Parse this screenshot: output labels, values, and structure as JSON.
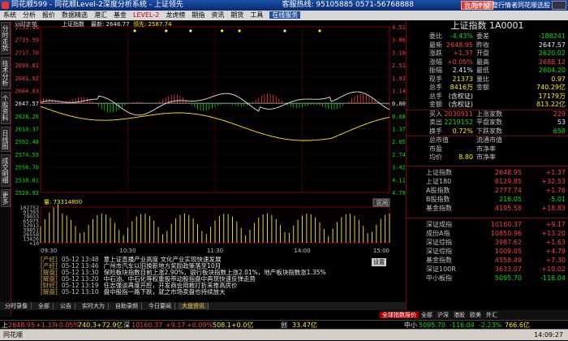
{
  "titlebar": {
    "title": "同花顺599 - 同花顺Level-2深度分析系统 - 上证领先",
    "hotline": "客服热线: 95105885  0571-56768888",
    "fav_label": "我的个股",
    "tip": "短时调整行情者同花顺选股"
  },
  "menu": [
    "系统",
    "分析",
    "报价",
    "数据精选",
    "港汇",
    "基金",
    "LEVEL-2",
    "龙虎榜",
    "期指",
    "资讯",
    "期货",
    "工具"
  ],
  "menu_highlight": "LEVEL-2",
  "menu_active": "在线服务",
  "left_tabs": [
    "分时走势",
    "技术分析",
    "个股资料",
    "日线图",
    "成交明细",
    "更多"
  ],
  "chart_header": {
    "label": "分时走势",
    "index_name": "上证指数",
    "latest": "最新: 2646.77",
    "leader": "领先: 2587.74"
  },
  "chart_data": {
    "type": "line",
    "y_ticks": [
      "2753.48",
      "2735.59",
      "2717.70",
      "2699.81",
      "2681.92",
      "2664.03",
      "2647.57",
      "2628.26",
      "2610.37",
      "2592.48",
      "2574.59",
      "2556.70",
      "2538.81",
      "2520.92"
    ],
    "pct_ticks": [
      "4.51%",
      "3.86%",
      "3.18%",
      "2.51%",
      "1.93%",
      "1.14%",
      "0.00%",
      "0.68%",
      "1.37%",
      "2.05%",
      "2.74%",
      "3.42%",
      "4.11%",
      "4.79%"
    ],
    "prev_close": 2647.57,
    "ylim": [
      2520.92,
      2753.48
    ],
    "x_ticks": [
      "09:30",
      "10:30",
      "11:30",
      "14:00",
      "15:00"
    ],
    "volume_label": "量: 73314800",
    "volume_ticks": [
      "102752",
      "91393",
      "79033",
      "65975",
      "52913",
      "39851",
      "26558",
      "13426",
      "×10"
    ],
    "reset_label": "区间",
    "series": []
  },
  "news": {
    "settings_label": "设置",
    "items": [
      {
        "tag": "[产经]",
        "time": "05-12 13:48",
        "title": "意上证直播产业高度 文化产业实现快速发展"
      },
      {
        "tag": "[产经]",
        "time": "05-12 13:46",
        "title": "广州市汽车以旧换新地方奖励政策落至10月"
      },
      {
        "tag": "[解盘]",
        "time": "05-12 13:30",
        "title": "保险板块指数目前上涨2.90%，银行板块指数上涨2.01%，地产板块指数涨1.35%"
      },
      {
        "tag": "[解盘]",
        "time": "05-12 13:20",
        "title": "中石油、中石化等权重股带动股指盘中再现快速反弹走势"
      },
      {
        "tag": "[财经]",
        "time": "05-12 13:19",
        "title": "任志强谈再度开腔，开发商会用救打折来推高房价"
      },
      {
        "tag": "[解盘]",
        "time": "05-12 13:10",
        "title": "盘中股指一路下跌，就之市场卖盘也持续放大"
      }
    ]
  },
  "news_tabs": [
    "分时录像",
    "全部",
    "公告",
    "实时大为",
    "自助录频",
    "今日要闻",
    "大盘资讯"
  ],
  "news_tab_active": "大盘资讯",
  "right_panel": {
    "title": "上证指数 1A0001",
    "rows": [
      {
        "l": "委比",
        "v": "-4.43%",
        "vc": "grn",
        "l2": "委差",
        "v2": "-188241",
        "v2c": "grn"
      },
      {
        "l": "最新",
        "v": "2648.95",
        "vc": "red",
        "l2": "昨收",
        "v2": "2647.57",
        "v2c": "wht"
      },
      {
        "l": "涨跌",
        "v": "+1.37",
        "vc": "red",
        "l2": "开盘",
        "v2": "2620.02",
        "v2c": "grn"
      },
      {
        "l": "涨幅",
        "v": "+0.05%",
        "vc": "red",
        "l2": "最高",
        "v2": "2688.12",
        "v2c": "red"
      },
      {
        "l": "振幅",
        "v": "2.41%",
        "vc": "wht",
        "l2": "最低",
        "v2": "2604.20",
        "v2c": "grn"
      },
      {
        "l": "现手",
        "v": "21373",
        "vc": "yel",
        "l2": "量比",
        "v2": "0.97",
        "v2c": "yel"
      },
      {
        "l": "总手",
        "v": "8416万",
        "vc": "yel",
        "l2": "金额",
        "v2": "740.29亿",
        "v2c": "yel"
      },
      {
        "l": "总手",
        "v": "(含权证)",
        "vc": "wht",
        "l2": "",
        "v2": "17179万",
        "v2c": "yel"
      },
      {
        "l": "金额",
        "v": "(含权证)",
        "vc": "wht",
        "l2": "",
        "v2": "813.22亿",
        "v2c": "yel"
      },
      {
        "l": "买入",
        "v": "2030911",
        "vc": "red",
        "l2": "上涨家数",
        "v2": "229",
        "v2c": "red"
      },
      {
        "l": "卖出",
        "v": "2219152",
        "vc": "grn",
        "l2": "平盘家数",
        "v2": "53",
        "v2c": "wht"
      },
      {
        "l": "换手",
        "v": "0.72%",
        "vc": "yel",
        "l2": "下跌家数",
        "v2": "658",
        "v2c": "grn"
      },
      {
        "l": "总市值",
        "v": "",
        "vc": "wht",
        "l2": "流通市值",
        "v2": "",
        "v2c": "wht"
      },
      {
        "l": "市盈",
        "v": "",
        "vc": "wht",
        "l2": "市净率",
        "v2": "",
        "v2c": "wht"
      },
      {
        "l": "均价",
        "v": "8.80",
        "vc": "yel",
        "l2": "市净率",
        "v2": "",
        "v2c": "wht"
      }
    ],
    "indices_a": [
      {
        "n": "上证指数",
        "p": "2648.95",
        "pc": "red",
        "c": "+1.37",
        "cc": "red"
      },
      {
        "n": "上证180",
        "p": "6129.85",
        "pc": "red",
        "c": "+32.53",
        "cc": "red"
      },
      {
        "n": "A股指数",
        "p": "2777.74",
        "pc": "red",
        "c": "+1.76",
        "cc": "red"
      },
      {
        "n": "B股指数",
        "p": "216.05",
        "pc": "grn",
        "c": "-5.01",
        "cc": "grn"
      },
      {
        "n": "基金指数",
        "p": "4195.58",
        "pc": "red",
        "c": "+18.83",
        "cc": "red"
      }
    ],
    "indices_b": [
      {
        "n": "深证成指",
        "p": "10160.37",
        "pc": "red",
        "c": "+9.17",
        "cc": "red"
      },
      {
        "n": "成份A指",
        "p": "10850.96",
        "pc": "red",
        "c": "+13.20",
        "cc": "red"
      },
      {
        "n": "深证综指",
        "p": "3987.62",
        "pc": "red",
        "c": "+1.63",
        "cc": "red"
      },
      {
        "n": "深证综指",
        "p": "1009.05",
        "pc": "red",
        "c": "+4.79",
        "cc": "red"
      },
      {
        "n": "基金指数",
        "p": "4558.49",
        "pc": "red",
        "c": "+7.30",
        "cc": "red"
      },
      {
        "n": "深证100R",
        "p": "3633.07",
        "pc": "red",
        "c": "+10.02",
        "cc": "red"
      },
      {
        "n": "中小板指",
        "p": "5095.70",
        "pc": "grn",
        "c": "-116.04",
        "cc": "grn"
      }
    ]
  },
  "global_tabs": [
    "全球指数报价",
    "全部",
    "沪深",
    "港股",
    "欧美",
    "外汇"
  ],
  "global_tab_active": "全球指数报价",
  "ticker": {
    "i1": "上",
    "v1": "2648.95",
    "c1": "+1.37",
    "p1": "+0.05%",
    "a1": "740.3+72.9亿",
    "i2": "深",
    "v2": "10160.37",
    "c2": "+9.17",
    "p2": "+0.09%",
    "a2": "508.1+0.0亿",
    "i3": "创",
    "v3": "33.47亿",
    "i4": "中小",
    "v4": "5095.70",
    "c4": "-116.04",
    "p4": "-2.23%",
    "a4": "766.6亿"
  },
  "status": {
    "brand": "同花顺",
    "time": "14:09:27"
  }
}
